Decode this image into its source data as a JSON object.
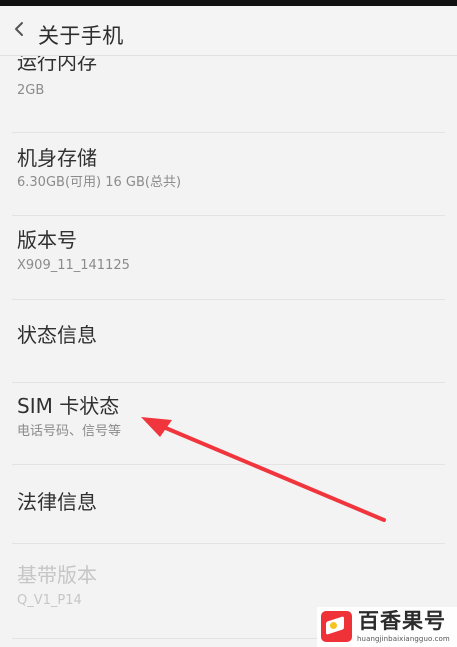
{
  "header": {
    "title": "关于手机"
  },
  "items": [
    {
      "title": "运行内存",
      "subtitle": "2GB"
    },
    {
      "title": "机身存储",
      "subtitle": "6.30GB(可用)   16 GB(总共)"
    },
    {
      "title": "版本号",
      "subtitle": "X909_11_141125"
    },
    {
      "title": "状态信息"
    },
    {
      "title": "SIM 卡状态",
      "subtitle": "电话号码、信号等"
    },
    {
      "title": "法律信息"
    },
    {
      "title": "基带版本",
      "subtitle": "Q_V1_P14"
    }
  ],
  "watermark": {
    "text": "百香果号",
    "domain": "huangjinbaixiangguo.com"
  },
  "colors": {
    "arrow": "#f0353d",
    "disabled_text": "#c6c6c6",
    "accent": "#ef3138"
  }
}
